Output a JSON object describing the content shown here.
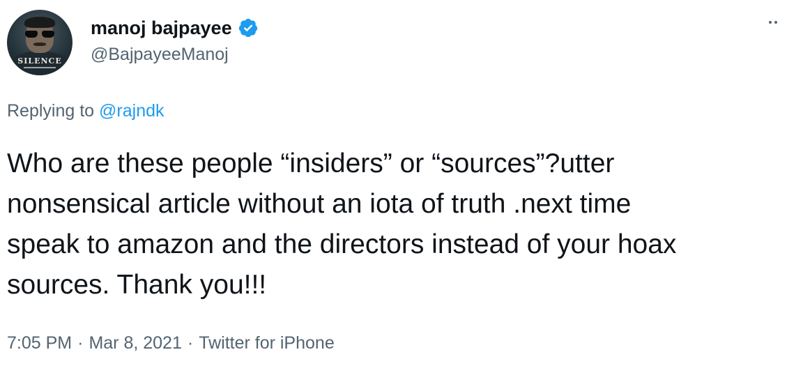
{
  "author": {
    "display_name": "manoj bajpayee",
    "handle": "@BajpayeeManoj",
    "verified_icon": "verified-badge-icon",
    "avatar_poster_text": "SILENCE"
  },
  "reply": {
    "prefix": "Replying to",
    "mention": "@rajndk"
  },
  "tweet": {
    "lines": [
      "Who are these people “insiders” or “sources”?utter",
      "nonsensical article without an iota of truth .next time",
      "speak to amazon and the directors instead of your hoax",
      "sources. Thank you!!!"
    ]
  },
  "meta": {
    "time": "7:05 PM",
    "separator": "·",
    "date": "Mar 8, 2021",
    "source": "Twitter for iPhone"
  },
  "colors": {
    "text": "#0f1419",
    "secondary": "#536471",
    "accent": "#1d9bf0"
  }
}
